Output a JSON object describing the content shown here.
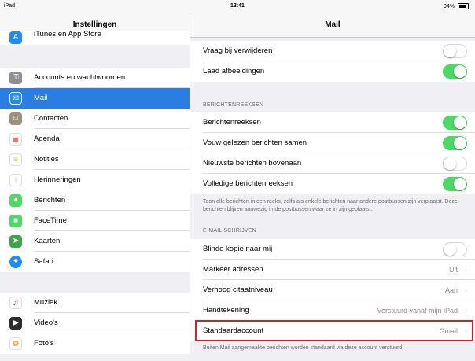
{
  "statusbar": {
    "device": "iPad",
    "time": "13:41",
    "battery": "94%"
  },
  "sidebar": {
    "title": "Instellingen",
    "items": [
      {
        "label": "iTunes en App Store",
        "icon": "app-store-icon",
        "color": "#1d8cf6"
      },
      {
        "label": "Accounts en wachtwoorden",
        "icon": "key-icon",
        "color": "#8e8e93"
      },
      {
        "label": "Mail",
        "icon": "envelope-icon",
        "color": "#1d8cf6"
      },
      {
        "label": "Contacten",
        "icon": "contacts-icon",
        "color": "#9b8f7e"
      },
      {
        "label": "Agenda",
        "icon": "calendar-icon",
        "color": "#ff3b30"
      },
      {
        "label": "Notities",
        "icon": "notes-icon",
        "color": "#f5c400"
      },
      {
        "label": "Herinneringen",
        "icon": "reminders-icon",
        "color": "#ffffff"
      },
      {
        "label": "Berichten",
        "icon": "messages-icon",
        "color": "#4cd964"
      },
      {
        "label": "FaceTime",
        "icon": "facetime-icon",
        "color": "#4cd964"
      },
      {
        "label": "Kaarten",
        "icon": "maps-icon",
        "color": "#3fa34d"
      },
      {
        "label": "Safari",
        "icon": "compass-icon",
        "color": "#1d8cf6"
      },
      {
        "label": "Muziek",
        "icon": "music-icon",
        "color": "#fc3158"
      },
      {
        "label": "Video's",
        "icon": "clapperboard-icon",
        "color": "#2c2c2e"
      },
      {
        "label": "Foto's",
        "icon": "photos-icon",
        "color": "#f7a31c"
      }
    ]
  },
  "main": {
    "title": "Mail",
    "rows_top": [
      {
        "label": "Vraag bij verwijderen",
        "toggle": false
      },
      {
        "label": "Laad afbeeldingen",
        "toggle": true
      }
    ],
    "threads_header": "BERICHTENREEKSEN",
    "thread_rows": [
      {
        "label": "Berichtenreeksen",
        "toggle": true
      },
      {
        "label": "Vouw gelezen berichten samen",
        "toggle": true
      },
      {
        "label": "Nieuwste berichten bovenaan",
        "toggle": false
      },
      {
        "label": "Volledige berichtenreeksen",
        "toggle": true
      }
    ],
    "threads_note": "Toon alle berichten in een reeks, zelfs als enkele berichten naar andere postbussen zijn verplaatst. Deze berichten blijven aanwezig in de postbussen waar ze in zijn geplaatst.",
    "compose_header": "E-MAIL SCHRIJVEN",
    "compose_rows": [
      {
        "label": "Blinde kopie naar mij",
        "toggle": false
      },
      {
        "label": "Markeer adressen",
        "value": "Uit"
      },
      {
        "label": "Verhoog citaatniveau",
        "value": "Aan"
      },
      {
        "label": "Handtekening",
        "value": "Verstuurd vanaf mijn iPad"
      },
      {
        "label": "Standaardaccount",
        "value": "Gmail"
      }
    ],
    "compose_note": "Buiten Mail aangemaakte berichten worden standaard via deze account verstuurd."
  }
}
